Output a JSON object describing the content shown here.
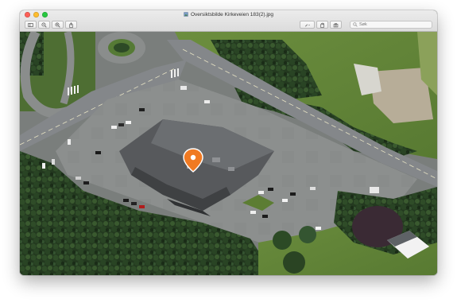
{
  "window": {
    "title": "Oversiktsbilde Kirkeveien 183(2).jpg"
  },
  "toolbar": {
    "left_buttons": [
      "sidebar-icon",
      "zoom-out-icon",
      "zoom-in-icon",
      "share-icon"
    ],
    "right_buttons": [
      "markup-icon",
      "rotate-icon",
      "toolbox-icon"
    ],
    "search_placeholder": "Søk"
  },
  "image": {
    "description_icon": "location-pin-icon",
    "pin_color": "#f07a22"
  }
}
